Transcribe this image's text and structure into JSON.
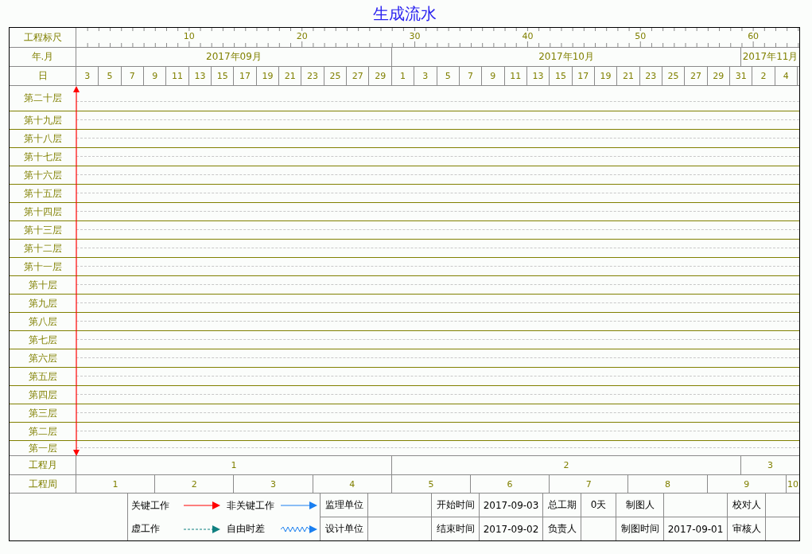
{
  "title": "生成流水",
  "ruler": {
    "label": "工程标尺",
    "ticks": [
      "10",
      "20",
      "30",
      "40",
      "50",
      "60"
    ]
  },
  "calendar_months": {
    "label": "年.月",
    "items": [
      "2017年09月",
      "2017年10月",
      "2017年11月"
    ]
  },
  "days": {
    "label": "日",
    "items": [
      "3",
      "5",
      "7",
      "9",
      "11",
      "13",
      "15",
      "17",
      "19",
      "21",
      "23",
      "25",
      "27",
      "29",
      "1",
      "3",
      "5",
      "7",
      "9",
      "11",
      "13",
      "15",
      "17",
      "19",
      "21",
      "23",
      "25",
      "27",
      "29",
      "31",
      "2",
      "4"
    ]
  },
  "floors": [
    "第二十层",
    "第十九层",
    "第十八层",
    "第十七层",
    "第十六层",
    "第十五层",
    "第十四层",
    "第十三层",
    "第十二层",
    "第十一层",
    "第十层",
    "第九层",
    "第八层",
    "第七层",
    "第六层",
    "第五层",
    "第四层",
    "第三层",
    "第二层",
    "第一层"
  ],
  "project_months": {
    "label": "工程月",
    "items": [
      "1",
      "2",
      "3"
    ]
  },
  "project_weeks": {
    "label": "工程周",
    "items": [
      "1",
      "2",
      "3",
      "4",
      "5",
      "6",
      "7",
      "8",
      "9",
      "10"
    ]
  },
  "legend": [
    {
      "label": "关键工作",
      "kind": "critical"
    },
    {
      "label": "非关键工作",
      "kind": "noncritical"
    },
    {
      "label": "虚工作",
      "kind": "dummy"
    },
    {
      "label": "自由时差",
      "kind": "float"
    }
  ],
  "info_rows": [
    [
      "监理单位",
      "",
      "开始时间",
      "2017-09-03",
      "总工期",
      "0天",
      "制图人",
      "",
      "校对人",
      ""
    ],
    [
      "设计单位",
      "",
      "结束时间",
      "2017-09-02",
      "负责人",
      "",
      "制图时间",
      "2017-09-01",
      "审核人",
      ""
    ]
  ]
}
